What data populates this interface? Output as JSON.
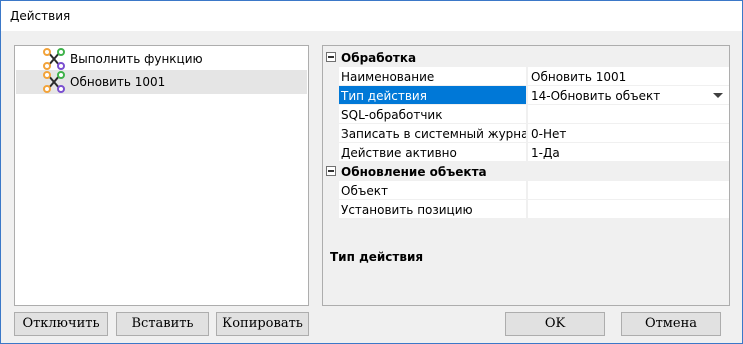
{
  "window": {
    "title": "Действия"
  },
  "tree": {
    "items": [
      {
        "label": "Выполнить функцию"
      },
      {
        "label": "Обновить 1001"
      }
    ]
  },
  "properties": {
    "categories": [
      {
        "label": "Обработка"
      },
      {
        "label": "Обновление объекта"
      }
    ],
    "rows": [
      {
        "name": "Наименование",
        "value": "Обновить 1001"
      },
      {
        "name": "Тип действия",
        "value": "14-Обновить объект"
      },
      {
        "name": "SQL-обработчик",
        "value": ""
      },
      {
        "name": "Записать в системный журнал",
        "value": "0-Нет"
      },
      {
        "name": "Действие активно",
        "value": "1-Да"
      },
      {
        "name": "Объект",
        "value": ""
      },
      {
        "name": "Установить позицию",
        "value": ""
      }
    ],
    "description_title": "Тип действия"
  },
  "buttons": {
    "disable": "Отключить",
    "insert": "Вставить",
    "copy": "Копировать",
    "ok": "OK",
    "cancel": "Отмена"
  },
  "colors": {
    "selection": "#0078d7",
    "icon_orange": "#f2a33a",
    "icon_green": "#3fb24a",
    "icon_purple": "#7a4fd0",
    "icon_dark": "#2b2b2b"
  }
}
